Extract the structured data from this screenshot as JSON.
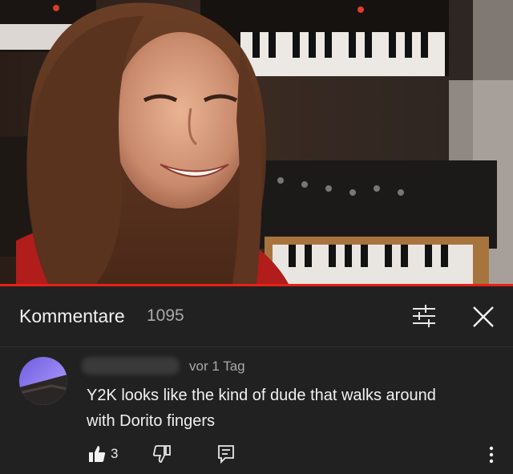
{
  "comments_panel": {
    "title": "Kommentare",
    "count": "1095",
    "icons": {
      "sort": "sort-filter-icon",
      "close": "close-icon"
    }
  },
  "comment": {
    "time": "vor 1 Tag",
    "text_lines": [
      "Y2K looks like the kind of dude that walks around",
      "with Dorito fingers"
    ],
    "likes": "3",
    "icons": {
      "like": "thumbs-up-icon",
      "dislike": "thumbs-down-icon",
      "reply": "reply-icon",
      "more": "more-vertical-icon"
    }
  },
  "colors": {
    "progress_bar": "#e62117",
    "panel_background": "#212121",
    "primary_text": "#f1f1f1",
    "secondary_text": "#aaaaaa"
  }
}
